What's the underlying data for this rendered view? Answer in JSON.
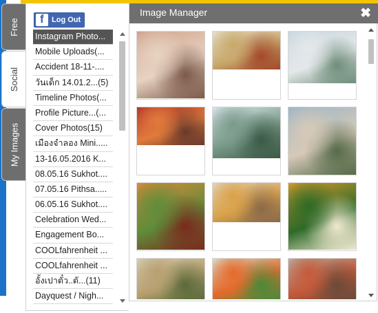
{
  "tabs": {
    "free": "Free",
    "social": "Social",
    "my_images": "My Images"
  },
  "facebook": {
    "logout_label": "Log Out"
  },
  "albums": [
    "Instagram Photo...",
    "Mobile Uploads(...",
    "Accident 18-11-....",
    "วันเด็ก 14.01.2...(5)",
    "Timeline Photos(...",
    "Profile Picture...(...",
    "Cover Photos(15)",
    "เมืองจำลอง Mini.....",
    "13-16.05.2016 K...",
    "08.05.16 Sukhot....",
    "07.05.16 Pithsa.....",
    "06.05.16 Sukhot....",
    "Celebration Wed...",
    "Engagement Bo...",
    "COOLfahrenheit ...",
    "COOLfahrenheit ...",
    "อั้งเปาตั๋ว..ตั...(11)",
    "Dayquest / Nigh..."
  ],
  "manager": {
    "title": "Image Manager",
    "close_symbol": "✖"
  },
  "photos": [
    {
      "name": "photo-cat",
      "colors": [
        "#cfa48c",
        "#e8d2c2",
        "#7c5a4a"
      ],
      "img_h": 97
    },
    {
      "name": "photo-dim-sum",
      "colors": [
        "#e9e2d0",
        "#c8a96c",
        "#a34a2c"
      ],
      "img_h": 55
    },
    {
      "name": "photo-beach",
      "colors": [
        "#c7d6dd",
        "#e4e8ea",
        "#6e8d7a"
      ],
      "img_h": 75
    },
    {
      "name": "photo-crab",
      "colors": [
        "#b03028",
        "#e07a3c",
        "#6a3a2a"
      ],
      "img_h": 55
    },
    {
      "name": "photo-viewpoint-selfie",
      "colors": [
        "#dce7ee",
        "#7a9a8a",
        "#3c5a46"
      ],
      "img_h": 74
    },
    {
      "name": "photo-picnic-collage",
      "colors": [
        "#9bb6c6",
        "#d7c9b8",
        "#546a48"
      ],
      "img_h": 98
    },
    {
      "name": "photo-thai-dishes",
      "colors": [
        "#d98a3a",
        "#5f8d3a",
        "#7a2a1e"
      ],
      "img_h": 97
    },
    {
      "name": "photo-soup-plates",
      "colors": [
        "#e6d7c0",
        "#d9a24a",
        "#8a6a4a"
      ],
      "img_h": 57
    },
    {
      "name": "photo-rice-bowl",
      "colors": [
        "#d39a2c",
        "#2e6a28",
        "#f0e8d0"
      ],
      "img_h": 97
    },
    {
      "name": "photo-noodle-soup",
      "colors": [
        "#d9cfb8",
        "#b7a070",
        "#5a6a3a"
      ],
      "img_h": 60
    },
    {
      "name": "photo-salad",
      "colors": [
        "#d8e2d0",
        "#e56a2c",
        "#4a8a3a"
      ],
      "img_h": 60
    },
    {
      "name": "photo-grilled-fish",
      "colors": [
        "#b8b0a6",
        "#c45a3a",
        "#6a4a3a"
      ],
      "img_h": 60
    }
  ]
}
